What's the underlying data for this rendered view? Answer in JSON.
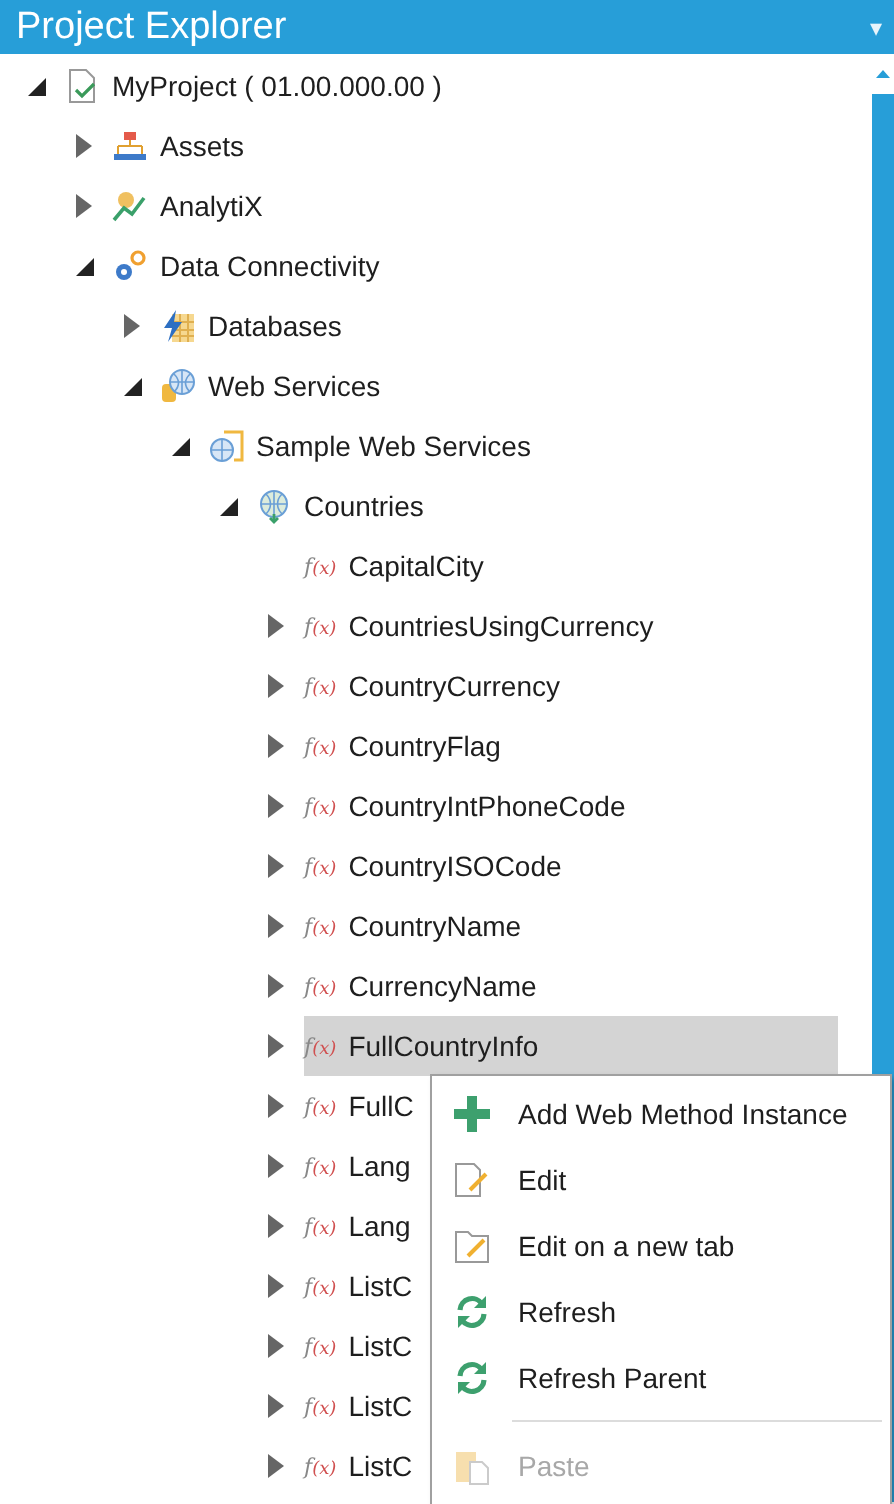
{
  "panel": {
    "title": "Project Explorer",
    "dropdown": "▾"
  },
  "tree": [
    {
      "label": "MyProject ( 01.00.000.00 )",
      "kind": "project",
      "expanded": true,
      "selected": false,
      "children": [
        {
          "label": "Assets",
          "kind": "assets",
          "expanded": false,
          "selected": false
        },
        {
          "label": "AnalytiX",
          "kind": "analytix",
          "expanded": false,
          "selected": false
        },
        {
          "label": "Data Connectivity",
          "kind": "connectivity",
          "expanded": true,
          "selected": false,
          "children": [
            {
              "label": "Databases",
              "kind": "databases",
              "expanded": false,
              "selected": false
            },
            {
              "label": "Web Services",
              "kind": "webservices",
              "expanded": true,
              "selected": false,
              "children": [
                {
                  "label": "Sample Web Services",
                  "kind": "service",
                  "expanded": true,
                  "selected": false,
                  "children": [
                    {
                      "label": "Countries",
                      "kind": "group",
                      "expanded": true,
                      "selected": false,
                      "children": [
                        {
                          "label": "CapitalCity",
                          "kind": "leaf-function",
                          "glyph": "f(x)",
                          "selected": false
                        },
                        {
                          "label": "CountriesUsingCurrency",
                          "kind": "function",
                          "glyph": "f(x)",
                          "expanded": false,
                          "selected": false
                        },
                        {
                          "label": "CountryCurrency",
                          "kind": "function",
                          "glyph": "f(x)",
                          "expanded": false,
                          "selected": false
                        },
                        {
                          "label": "CountryFlag",
                          "kind": "function",
                          "glyph": "f(x)",
                          "expanded": false,
                          "selected": false
                        },
                        {
                          "label": "CountryIntPhoneCode",
                          "kind": "function",
                          "glyph": "f(x)",
                          "expanded": false,
                          "selected": false
                        },
                        {
                          "label": "CountryISOCode",
                          "kind": "function",
                          "glyph": "f(x)",
                          "expanded": false,
                          "selected": false
                        },
                        {
                          "label": "CountryName",
                          "kind": "function",
                          "glyph": "f(x)",
                          "expanded": false,
                          "selected": false
                        },
                        {
                          "label": "CurrencyName",
                          "kind": "function",
                          "glyph": "f(x)",
                          "expanded": false,
                          "selected": false
                        },
                        {
                          "label": "FullCountryInfo",
                          "kind": "function",
                          "glyph": "f(x)",
                          "expanded": false,
                          "selected": true
                        },
                        {
                          "label": "FullC",
                          "kind": "function",
                          "glyph": "f(x)",
                          "expanded": false,
                          "selected": false
                        },
                        {
                          "label": "Lang",
                          "kind": "function",
                          "glyph": "f(x)",
                          "expanded": false,
                          "selected": false
                        },
                        {
                          "label": "Lang",
                          "kind": "function",
                          "glyph": "f(x)",
                          "expanded": false,
                          "selected": false
                        },
                        {
                          "label": "ListC",
                          "kind": "function",
                          "glyph": "f(x)",
                          "expanded": false,
                          "selected": false
                        },
                        {
                          "label": "ListC",
                          "kind": "function",
                          "glyph": "f(x)",
                          "expanded": false,
                          "selected": false
                        },
                        {
                          "label": "ListC",
                          "kind": "function",
                          "glyph": "f(x)",
                          "expanded": false,
                          "selected": false
                        },
                        {
                          "label": "ListC",
                          "kind": "function",
                          "glyph": "f(x)",
                          "expanded": false,
                          "selected": false
                        }
                      ]
                    }
                  ]
                }
              ]
            }
          ]
        }
      ]
    }
  ],
  "context_menu": [
    {
      "kind": "add",
      "label": "Add Web Method Instance",
      "disabled": false
    },
    {
      "kind": "edit",
      "label": "Edit",
      "disabled": false
    },
    {
      "kind": "edit-tab",
      "label": "Edit on a new tab",
      "disabled": false
    },
    {
      "kind": "refresh",
      "label": "Refresh",
      "disabled": false
    },
    {
      "kind": "refresh",
      "label": "Refresh Parent",
      "disabled": false
    },
    {
      "kind": "separator"
    },
    {
      "kind": "paste",
      "label": "Paste",
      "disabled": true
    }
  ]
}
